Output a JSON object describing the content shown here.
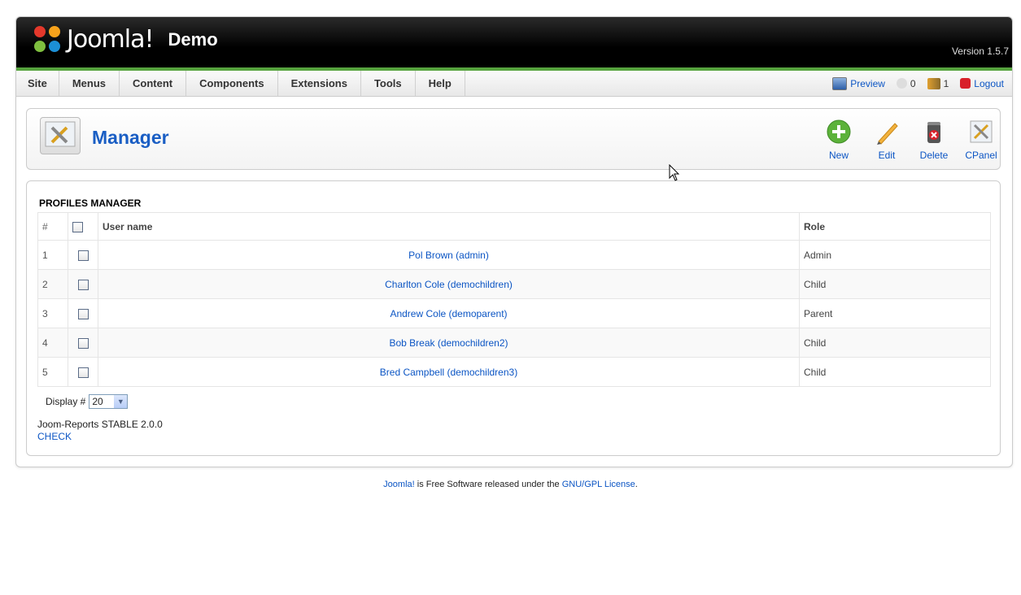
{
  "header": {
    "logo_text": "Joomla!",
    "site_name": "Demo",
    "version": "Version 1.5.7"
  },
  "menu": {
    "items": [
      "Site",
      "Menus",
      "Content",
      "Components",
      "Extensions",
      "Tools",
      "Help"
    ]
  },
  "status": {
    "preview": "Preview",
    "messages_count": "0",
    "users_count": "1",
    "logout": "Logout"
  },
  "toolbar": {
    "title": "Manager",
    "buttons": {
      "new": "New",
      "edit": "Edit",
      "delete": "Delete",
      "cpanel": "CPanel"
    }
  },
  "profiles": {
    "title": "PROFILES MANAGER",
    "columns": {
      "num": "#",
      "user_name": "User name",
      "role": "Role"
    },
    "rows": [
      {
        "num": "1",
        "name": "Pol Brown (admin)",
        "role": "Admin"
      },
      {
        "num": "2",
        "name": "Charlton Cole (demochildren)",
        "role": "Child"
      },
      {
        "num": "3",
        "name": "Andrew Cole (demoparent)",
        "role": "Parent"
      },
      {
        "num": "4",
        "name": "Bob Break (demochildren2)",
        "role": "Child"
      },
      {
        "num": "5",
        "name": "Bred Campbell (demochildren3)",
        "role": "Child"
      }
    ],
    "display_label": "Display #",
    "display_value": "20",
    "product": "Joom-Reports STABLE 2.0.0",
    "check_link": "CHECK"
  },
  "footer": {
    "joomla_link": "Joomla!",
    "text": " is Free Software released under the ",
    "license_link": "GNU/GPL License",
    "period": "."
  }
}
